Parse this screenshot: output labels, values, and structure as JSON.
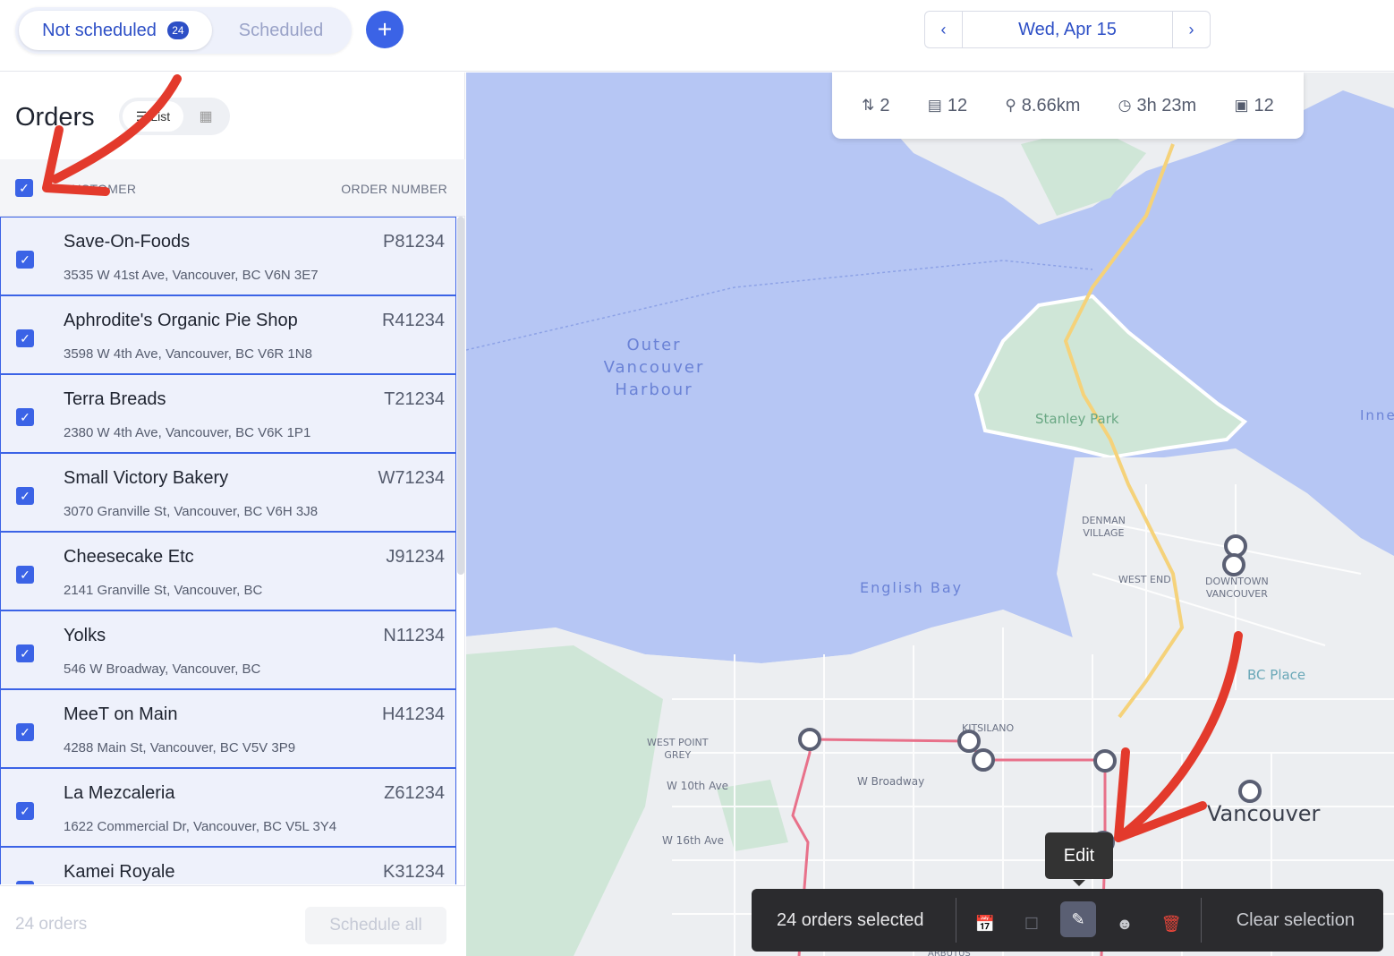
{
  "top": {
    "tab_active": "Not scheduled",
    "tab_active_badge": "24",
    "tab_inactive": "Scheduled",
    "add_label": "+",
    "date": "Wed, Apr 15"
  },
  "panel": {
    "title": "Orders",
    "view_list_label": "List",
    "col_customer": "CUSTOMER",
    "col_order": "ORDER NUMBER",
    "count": "24 orders",
    "schedule_all": "Schedule all"
  },
  "orders": [
    {
      "name": "Save-On-Foods",
      "num": "P81234",
      "addr": "3535 W 41st Ave, Vancouver, BC V6N 3E7"
    },
    {
      "name": "Aphrodite's Organic Pie Shop",
      "num": "R41234",
      "addr": "3598 W 4th Ave, Vancouver, BC V6R 1N8"
    },
    {
      "name": "Terra Breads",
      "num": "T21234",
      "addr": "2380 W 4th Ave, Vancouver, BC V6K 1P1"
    },
    {
      "name": "Small Victory Bakery",
      "num": "W71234",
      "addr": "3070 Granville St, Vancouver, BC V6H 3J8"
    },
    {
      "name": "Cheesecake Etc",
      "num": "J91234",
      "addr": "2141 Granville St, Vancouver, BC"
    },
    {
      "name": "Yolks",
      "num": "N11234",
      "addr": "546 W Broadway, Vancouver, BC"
    },
    {
      "name": "MeeT on Main",
      "num": "H41234",
      "addr": "4288 Main St, Vancouver, BC V5V 3P9"
    },
    {
      "name": "La Mezcaleria",
      "num": "Z61234",
      "addr": "1622 Commercial Dr, Vancouver, BC V5L 3Y4"
    },
    {
      "name": "Kamei Royale",
      "num": "K31234",
      "addr": ""
    }
  ],
  "stats": {
    "routes": "2",
    "stops": "12",
    "distance": "8.66km",
    "duration": "3h 23m",
    "orders": "12"
  },
  "map_labels": {
    "outer_harbour_1": "Outer",
    "outer_harbour_2": "Vancouver",
    "outer_harbour_3": "Harbour",
    "stanley": "Stanley Park",
    "english_bay": "English Bay",
    "denman_1": "DENMAN",
    "denman_2": "VILLAGE",
    "west_end": "WEST END",
    "downtown_1": "DOWNTOWN",
    "downtown_2": "VANCOUVER",
    "bc_place": "BC Place",
    "kitsilano": "KITSILANO",
    "westpoint_1": "WEST POINT",
    "westpoint_2": "GREY",
    "w10": "W 10th Ave",
    "w16": "W 16th Ave",
    "broadway": "W Broadway",
    "vancouver": "Vancouver",
    "inner": "Inne",
    "arbutus": "ARBUTUS"
  },
  "actionbar": {
    "selected": "24 orders selected",
    "tooltip": "Edit",
    "clear": "Clear selection"
  },
  "colors": {
    "accent": "#3b63e6",
    "water": "#b6c6f4",
    "park": "#cfe6d7",
    "route": "#e8718a",
    "annotation": "#e33a2c"
  }
}
